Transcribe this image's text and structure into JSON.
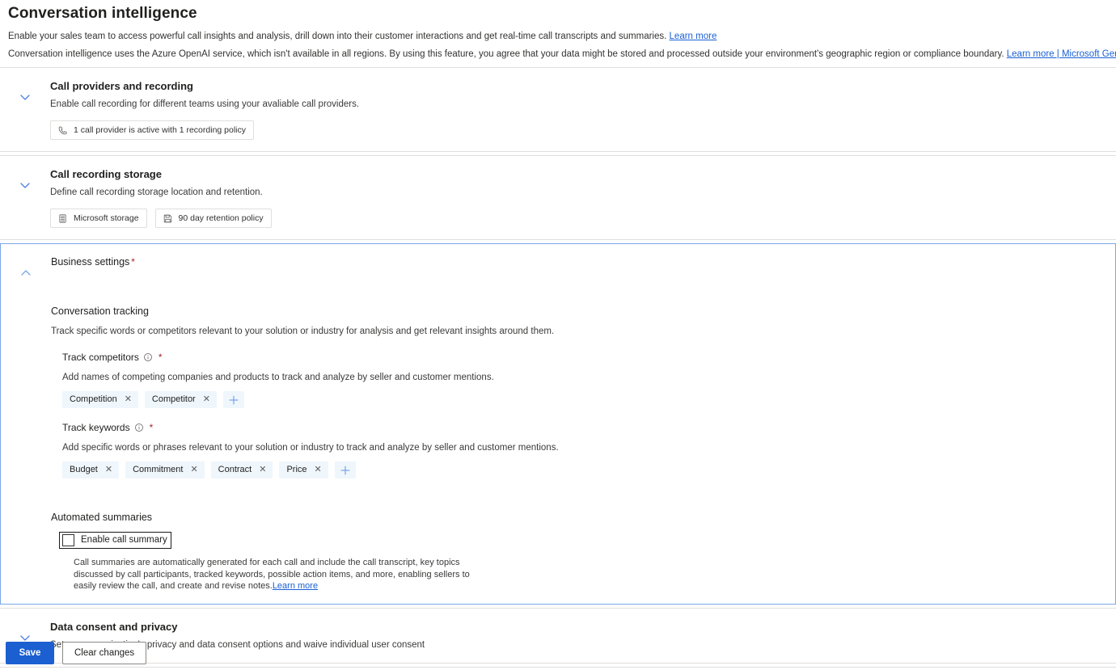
{
  "header": {
    "title": "Conversation intelligence",
    "intro_1_text": "Enable your sales team to access powerful call insights and analysis, drill down into their customer interactions and get real-time call transcripts and summaries.",
    "intro_1_link": "Learn more",
    "intro_2_text": "Conversation intelligence uses the Azure OpenAI service, which isn't available in all regions. By using this feature, you agree that your data might be stored and processed outside your environment's geographic region or compliance boundary.",
    "intro_2_link": "Learn more | Microsoft Generative AI Services terms"
  },
  "colors": {
    "accent": "#1b5fd0",
    "link": "#1a5fd6",
    "chip_bg": "#eff6fc",
    "required": "#a4262c",
    "card_border": "#e1dfdd",
    "expanded_border": "#7aa6e8"
  },
  "cards": {
    "call_providers": {
      "title": "Call providers and recording",
      "subtitle": "Enable call recording for different teams using your avaliable call providers.",
      "chevron": "chevron-down-icon",
      "badges": [
        {
          "icon": "phone-icon",
          "label": "1 call provider is active with 1 recording policy"
        }
      ]
    },
    "call_storage": {
      "title": "Call recording storage",
      "subtitle": "Define call recording storage location and retention.",
      "chevron": "chevron-down-icon",
      "badges": [
        {
          "icon": "database-icon",
          "label": "Microsoft storage"
        },
        {
          "icon": "save-icon",
          "label": "90 day retention policy"
        }
      ]
    },
    "business_settings": {
      "title": "Business settings",
      "required_marker": "*",
      "chevron": "chevron-up-icon",
      "conversation_tracking": {
        "heading": "Conversation tracking",
        "description": "Track specific words or competitors relevant to your solution or industry for analysis and get relevant insights around them.",
        "track_competitors": {
          "label": "Track competitors",
          "info_icon": "info-icon",
          "required_marker": "*",
          "description": "Add names of competing companies and products to track and analyze by seller and customer mentions.",
          "chips": [
            "Competition",
            "Competitor"
          ],
          "add_label": "+"
        },
        "track_keywords": {
          "label": "Track keywords",
          "info_icon": "info-icon",
          "required_marker": "*",
          "description": "Add specific words or phrases relevant to your solution or industry to track and analyze by seller and customer mentions.",
          "chips": [
            "Budget",
            "Commitment",
            "Contract",
            "Price"
          ],
          "add_label": "+"
        }
      },
      "automated_summaries": {
        "heading": "Automated summaries",
        "checkbox_label": "Enable call summary",
        "checkbox_checked": false,
        "description": "Call summaries are automatically generated for each call and include the call transcript, key topics discussed by call participants, tracked keywords, possible action items, and more, enabling sellers to easily review the call, and create and revise notes.",
        "link": "Learn more"
      }
    },
    "data_consent": {
      "title": "Data consent and privacy",
      "subtitle": "Set your organization's privacy and data consent options and waive individual user consent",
      "chevron": "chevron-down-icon"
    }
  },
  "footer": {
    "save_label": "Save",
    "clear_label": "Clear changes"
  }
}
